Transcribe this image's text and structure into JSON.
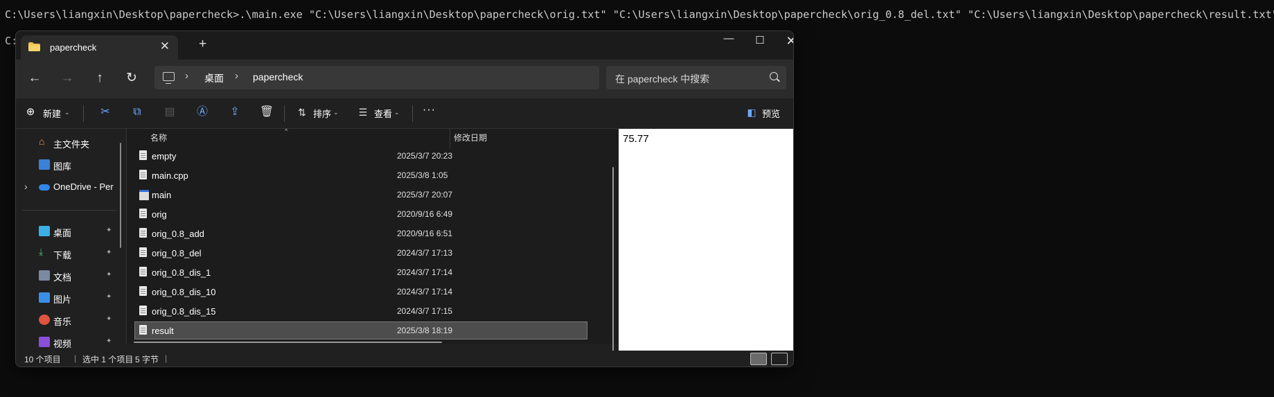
{
  "terminal": {
    "line1": "C:\\Users\\liangxin\\Desktop\\papercheck>.\\main.exe \"C:\\Users\\liangxin\\Desktop\\papercheck\\orig.txt\" \"C:\\Users\\liangxin\\Desktop\\papercheck\\orig_0.8_del.txt\" \"C:\\Users\\liangxin\\Desktop\\papercheck\\result.txt\"",
    "line2": "C:"
  },
  "window": {
    "tab_title": "papercheck",
    "close_tab": "✕",
    "new_tab": "+",
    "minimize": "—",
    "maximize": "☐",
    "close": "✕"
  },
  "nav": {
    "back": "←",
    "forward": "→",
    "up": "↑",
    "refresh": "↻",
    "chevron": "›",
    "breadcrumb": [
      "桌面",
      "papercheck"
    ],
    "search_placeholder": "在 papercheck 中搜索"
  },
  "toolbar": {
    "new_label": "新建",
    "sort_label": "排序",
    "view_label": "查看",
    "more": "···",
    "preview_label": "预览"
  },
  "sidebar": {
    "items": [
      {
        "label": "主文件夹",
        "icon": "home-icon"
      },
      {
        "label": "图库",
        "icon": "gallery-icon"
      },
      {
        "label": "OneDrive - Per",
        "icon": "onedrive-icon",
        "expand": "›"
      },
      {
        "label": "桌面",
        "icon": "desktop-icon",
        "pin": "📌"
      },
      {
        "label": "下载",
        "icon": "download-icon",
        "pin": "📌"
      },
      {
        "label": "文档",
        "icon": "documents-icon",
        "pin": "📌"
      },
      {
        "label": "图片",
        "icon": "pictures-icon",
        "pin": "📌"
      },
      {
        "label": "音乐",
        "icon": "music-icon",
        "pin": "📌"
      },
      {
        "label": "视频",
        "icon": "video-icon",
        "pin": "📌"
      }
    ]
  },
  "file_list": {
    "columns": {
      "name": "名称",
      "date": "修改日期",
      "sort_caret": "^"
    },
    "files": [
      {
        "name": "empty",
        "date": "2025/3/7 20:23",
        "selected": false
      },
      {
        "name": "main.cpp",
        "date": "2025/3/8 1:05",
        "selected": false
      },
      {
        "name": "main",
        "date": "2025/3/7 20:07",
        "selected": false
      },
      {
        "name": "orig",
        "date": "2020/9/16 6:49",
        "selected": false
      },
      {
        "name": "orig_0.8_add",
        "date": "2020/9/16 6:51",
        "selected": false
      },
      {
        "name": "orig_0.8_del",
        "date": "2024/3/7 17:13",
        "selected": false
      },
      {
        "name": "orig_0.8_dis_1",
        "date": "2024/3/7 17:14",
        "selected": false
      },
      {
        "name": "orig_0.8_dis_10",
        "date": "2024/3/7 17:14",
        "selected": false
      },
      {
        "name": "orig_0.8_dis_15",
        "date": "2024/3/7 17:15",
        "selected": false
      },
      {
        "name": "result",
        "date": "2025/3/8 18:19",
        "selected": true
      }
    ]
  },
  "preview": {
    "content": "75.77"
  },
  "status": {
    "item_count": "10 个项目",
    "selection": "选中 1 个项目",
    "size": "5 字节",
    "divider": "|"
  }
}
